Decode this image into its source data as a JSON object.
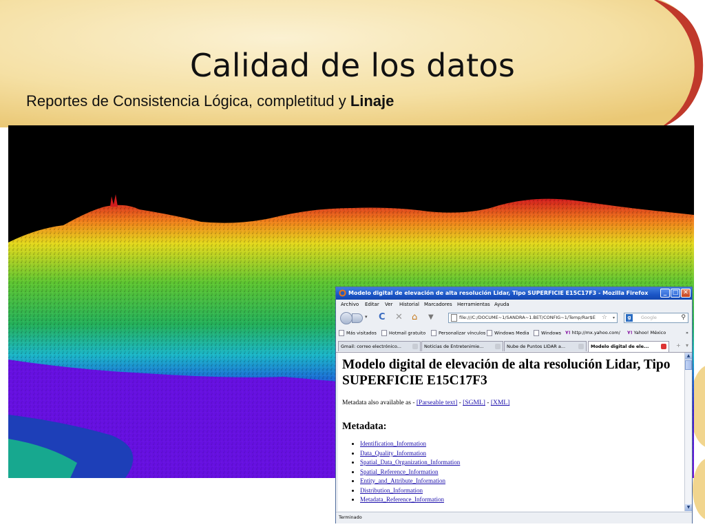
{
  "slide": {
    "title": "Calidad de los datos",
    "subtitle_prefix": "Reportes de Consistencia Lógica, completitud y ",
    "subtitle_bold": "Linaje"
  },
  "image": {
    "description_icon": "lidar-point-cloud-image"
  },
  "window": {
    "title": "Modelo digital de elevación de alta resolución Lidar, Tipo SUPERFICIE E15C17F3 - Mozilla Firefox",
    "menu": [
      "Archivo",
      "Editar",
      "Ver",
      "Historial",
      "Marcadores",
      "Herramientas",
      "Ayuda"
    ],
    "url": "file:///C:/DOCUME~1/SANDRA~1.BET/CONFIG~1/Temp/Rar$E",
    "search_placeholder": "Google",
    "bookmarks": [
      "Más visitados",
      "Hotmail gratuito",
      "Personalizar vínculos",
      "Windows Media",
      "Windows",
      "http://mx.yahoo.com/",
      "Yahoo! México"
    ],
    "tabs": [
      "Gmail: correo electrónico...",
      "Noticias de Entretenimie...",
      "Nube de Puntos LIDAR a...",
      "Modelo digital de ele..."
    ],
    "status": "Terminado"
  },
  "page": {
    "heading": "Modelo digital de elevación de alta resolución Lidar, Tipo SUPERFICIE E15C17F3",
    "meta_prefix": "Metadata also available as - ",
    "meta_links": [
      "[Parseable text]",
      "[SGML]",
      "[XML]"
    ],
    "meta_sep": " - ",
    "section": "Metadata:",
    "toc": [
      "Identification_Information",
      "Data_Quality_Information",
      "Spatial_Data_Organization_Information",
      "Spatial_Reference_Information",
      "Entity_and_Attribute_Information",
      "Distribution_Information",
      "Metadata_Reference_Information"
    ]
  },
  "colors": {
    "accent_red": "#c0392b",
    "accent_gold": "#f1d58e",
    "titlebar_blue": "#1b55c6"
  }
}
